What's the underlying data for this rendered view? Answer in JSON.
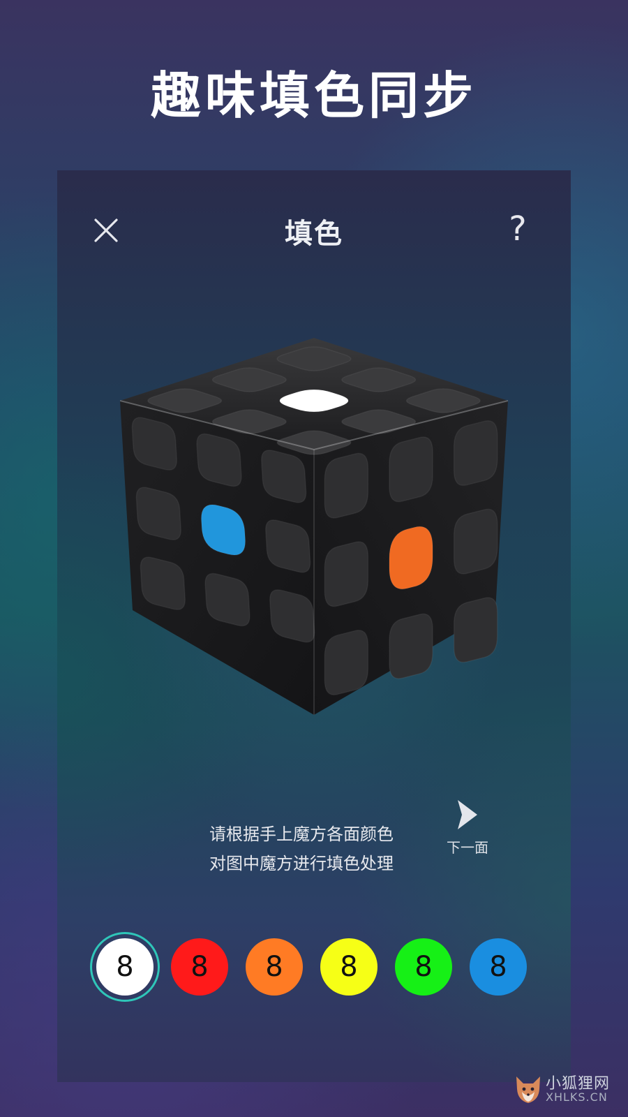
{
  "headline": "趣味填色同步",
  "screen": {
    "title": "填色",
    "help_label": "?"
  },
  "cube_stickers": {
    "top_center": "#ffffff",
    "left_center": "#2196dc",
    "right_center": "#f06a22",
    "body": "#2f2f31"
  },
  "instruction": {
    "line1": "请根据手上魔方各面颜色",
    "line2": "对图中魔方进行填色处理"
  },
  "next": {
    "label": "下一面"
  },
  "palette": [
    {
      "color": "#ffffff",
      "count": "8",
      "selected": true
    },
    {
      "color": "#ff1a1a",
      "count": "8",
      "selected": false
    },
    {
      "color": "#ff7b24",
      "count": "8",
      "selected": false
    },
    {
      "color": "#f6ff16",
      "count": "8",
      "selected": false
    },
    {
      "color": "#16f016",
      "count": "8",
      "selected": false
    },
    {
      "color": "#1a8ee0",
      "count": "8",
      "selected": false
    }
  ],
  "watermark": {
    "name_cn": "小狐狸网",
    "name_en": "XHLKS.CN"
  }
}
